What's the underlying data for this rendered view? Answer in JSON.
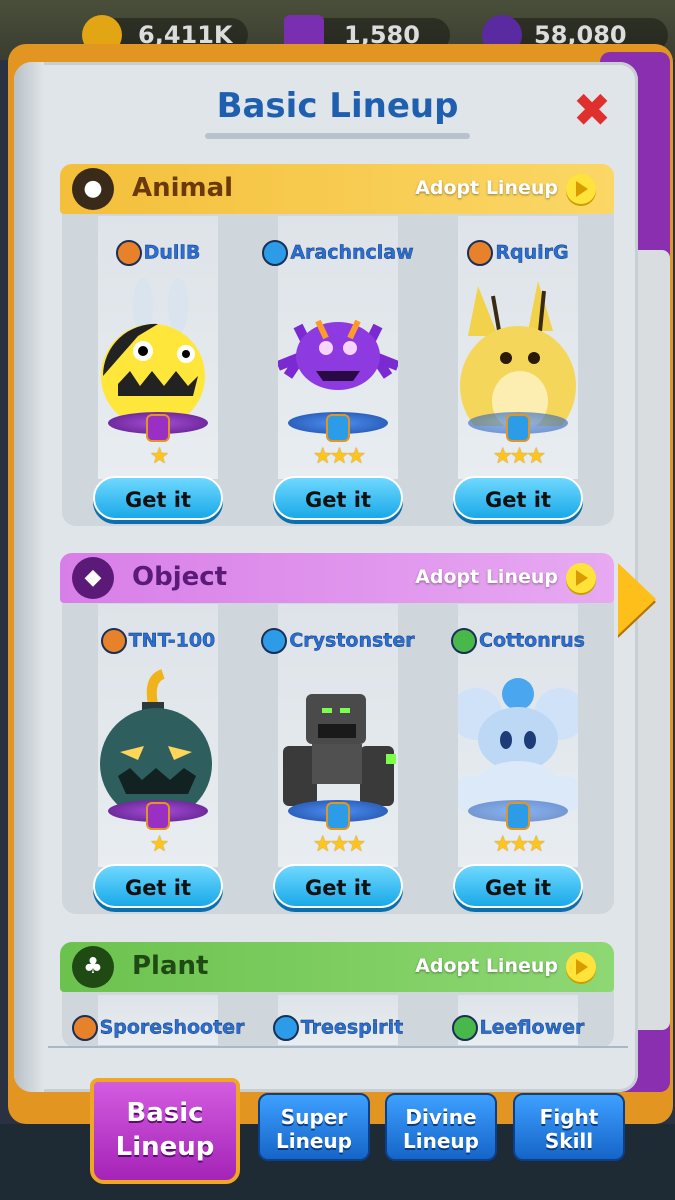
{
  "resources": [
    {
      "icon": "coin-icon",
      "value": "6,411K"
    },
    {
      "icon": "gem-icon",
      "value": "1,580"
    },
    {
      "icon": "token-icon",
      "value": "58,080"
    }
  ],
  "title": "Basic Lineup",
  "close_icon": "close-x-icon",
  "adopt_label": "Adopt Lineup",
  "get_label": "Get it",
  "sections": [
    {
      "title": "Animal",
      "icon": "paw-icon",
      "color": "#f2b93a",
      "monsters": [
        {
          "name": "DullB",
          "role_color": "#e7822a",
          "stars": "★",
          "badge": "#9a2fc4"
        },
        {
          "name": "Arachnclaw",
          "role_color": "#2c9ce8",
          "stars": "★★★",
          "badge": "#2c9ce8"
        },
        {
          "name": "RquirG",
          "role_color": "#e7822a",
          "stars": "★★★",
          "badge": "#2c9ce8"
        }
      ]
    },
    {
      "title": "Object",
      "icon": "crystal-icon",
      "color": "#d981e8",
      "monsters": [
        {
          "name": "TNT-100",
          "role_color": "#e7822a",
          "stars": "★",
          "badge": "#9a2fc4"
        },
        {
          "name": "Crystonster",
          "role_color": "#2c9ce8",
          "stars": "★★★",
          "badge": "#2c9ce8"
        },
        {
          "name": "Cottonrus",
          "role_color": "#49b84a",
          "stars": "★★★",
          "badge": "#2c9ce8"
        }
      ]
    },
    {
      "title": "Plant",
      "icon": "clover-icon",
      "color": "#7fcc5e",
      "monsters": [
        {
          "name": "Sporeshooter",
          "role_color": "#e7822a"
        },
        {
          "name": "Treespirit",
          "role_color": "#2c9ce8"
        },
        {
          "name": "Leeflower",
          "role_color": "#49b84a"
        }
      ]
    }
  ],
  "tabs": [
    {
      "label_1": "Basic",
      "label_2": "Lineup",
      "active": true
    },
    {
      "label_1": "Super",
      "label_2": "Lineup",
      "active": false
    },
    {
      "label_1": "Divine",
      "label_2": "Lineup",
      "active": false
    },
    {
      "label_1": "Fight",
      "label_2": "Skill",
      "active": false
    }
  ]
}
